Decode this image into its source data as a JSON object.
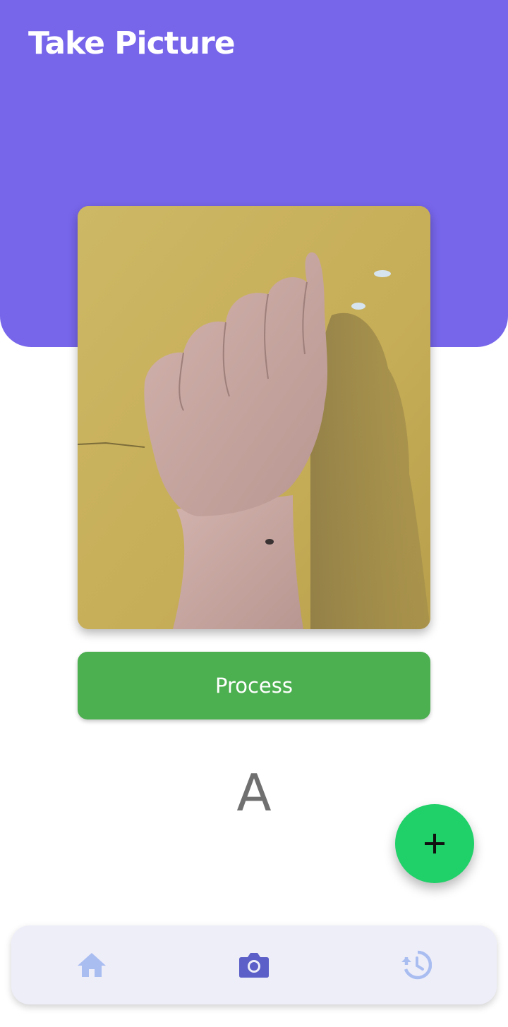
{
  "header": {
    "title": "Take Picture"
  },
  "photo": {
    "subject": "hand sign photo"
  },
  "actions": {
    "process_label": "Process"
  },
  "result": {
    "letter": "A"
  },
  "fab": {
    "icon": "plus-icon"
  },
  "bottom_nav": {
    "items": [
      {
        "icon": "home-icon",
        "active": false
      },
      {
        "icon": "camera-icon",
        "active": true
      },
      {
        "icon": "history-icon",
        "active": false
      }
    ]
  },
  "colors": {
    "header_bg": "#7766ea",
    "process_button": "#4caf50",
    "fab_bg": "#1fd168",
    "nav_bg": "#eeeef9",
    "nav_active": "#5b5fc7",
    "nav_inactive": "#a9bdf1"
  }
}
